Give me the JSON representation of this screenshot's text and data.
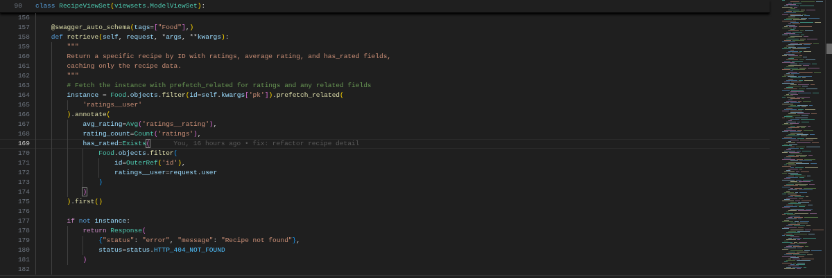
{
  "sticky_line": {
    "number": "90",
    "tokens": [
      {
        "kind": "kw",
        "text": "class "
      },
      {
        "kind": "cls",
        "text": "RecipeViewSet"
      },
      {
        "kind": "p1",
        "text": "("
      },
      {
        "kind": "cls",
        "text": "viewsets"
      },
      {
        "kind": "op",
        "text": "."
      },
      {
        "kind": "cls",
        "text": "ModelViewSet"
      },
      {
        "kind": "p1",
        "text": ")"
      },
      {
        "kind": "op",
        "text": ":"
      }
    ]
  },
  "lines": [
    {
      "number": "156",
      "current": false
    },
    {
      "number": "157",
      "current": false,
      "tokens": [
        {
          "kind": "fn",
          "text": "@swagger_auto_schema"
        },
        {
          "kind": "p1",
          "text": "("
        },
        {
          "kind": "var",
          "text": "tags"
        },
        {
          "kind": "op",
          "text": "="
        },
        {
          "kind": "p2",
          "text": "["
        },
        {
          "kind": "str",
          "text": "\"Food\""
        },
        {
          "kind": "p2",
          "text": "]"
        },
        {
          "kind": "op",
          "text": ","
        },
        {
          "kind": "p1",
          "text": ")"
        }
      ]
    },
    {
      "number": "158",
      "current": false,
      "tokens": [
        {
          "kind": "kw",
          "text": "def "
        },
        {
          "kind": "fn",
          "text": "retrieve"
        },
        {
          "kind": "p1",
          "text": "("
        },
        {
          "kind": "var",
          "text": "self"
        },
        {
          "kind": "op",
          "text": ", "
        },
        {
          "kind": "var",
          "text": "request"
        },
        {
          "kind": "op",
          "text": ", *"
        },
        {
          "kind": "var",
          "text": "args"
        },
        {
          "kind": "op",
          "text": ", **"
        },
        {
          "kind": "var",
          "text": "kwargs"
        },
        {
          "kind": "p1",
          "text": ")"
        },
        {
          "kind": "op",
          "text": ":"
        }
      ],
      "children": [
        {
          "number": "159",
          "current": false,
          "tokens": [
            {
              "kind": "str",
              "text": "\"\"\""
            }
          ]
        },
        {
          "number": "160",
          "current": false,
          "tokens": [
            {
              "kind": "str",
              "text": "Return a specific recipe by ID with ratings, average rating, and has_rated fields,"
            }
          ]
        },
        {
          "number": "161",
          "current": false,
          "tokens": [
            {
              "kind": "str",
              "text": "caching only the recipe data."
            }
          ]
        },
        {
          "number": "162",
          "current": false,
          "tokens": [
            {
              "kind": "str",
              "text": "\"\"\""
            }
          ]
        },
        {
          "number": "163",
          "current": false,
          "tokens": [
            {
              "kind": "com",
              "text": "# Fetch the instance with prefetch_related for ratings and any related fields"
            }
          ]
        },
        {
          "number": "164",
          "current": false,
          "tokens": [
            {
              "kind": "var",
              "text": "instance"
            },
            {
              "kind": "op",
              "text": " = "
            },
            {
              "kind": "cls",
              "text": "Food"
            },
            {
              "kind": "op",
              "text": "."
            },
            {
              "kind": "var",
              "text": "objects"
            },
            {
              "kind": "op",
              "text": "."
            },
            {
              "kind": "fn",
              "text": "filter"
            },
            {
              "kind": "p1",
              "text": "("
            },
            {
              "kind": "var",
              "text": "id"
            },
            {
              "kind": "op",
              "text": "="
            },
            {
              "kind": "var",
              "text": "self"
            },
            {
              "kind": "op",
              "text": "."
            },
            {
              "kind": "var",
              "text": "kwargs"
            },
            {
              "kind": "p2",
              "text": "["
            },
            {
              "kind": "str",
              "text": "'pk'"
            },
            {
              "kind": "p2",
              "text": "]"
            },
            {
              "kind": "p1",
              "text": ")"
            },
            {
              "kind": "op",
              "text": "."
            },
            {
              "kind": "fn",
              "text": "prefetch_related"
            },
            {
              "kind": "p1",
              "text": "("
            }
          ],
          "children": [
            {
              "number": "165",
              "current": false,
              "tokens": [
                {
                  "kind": "str",
                  "text": "'ratings__user'"
                }
              ]
            }
          ]
        },
        {
          "number": "166",
          "current": false,
          "tokens": [
            {
              "kind": "p1",
              "text": ")"
            },
            {
              "kind": "op",
              "text": "."
            },
            {
              "kind": "fn",
              "text": "annotate"
            },
            {
              "kind": "p1",
              "text": "("
            }
          ],
          "children": [
            {
              "number": "167",
              "current": false,
              "tokens": [
                {
                  "kind": "var",
                  "text": "avg_rating"
                },
                {
                  "kind": "op",
                  "text": "="
                },
                {
                  "kind": "cls",
                  "text": "Avg"
                },
                {
                  "kind": "p2",
                  "text": "("
                },
                {
                  "kind": "str",
                  "text": "'ratings__rating'"
                },
                {
                  "kind": "p2",
                  "text": ")"
                },
                {
                  "kind": "op",
                  "text": ","
                }
              ]
            },
            {
              "number": "168",
              "current": false,
              "tokens": [
                {
                  "kind": "var",
                  "text": "rating_count"
                },
                {
                  "kind": "op",
                  "text": "="
                },
                {
                  "kind": "cls",
                  "text": "Count"
                },
                {
                  "kind": "p2",
                  "text": "("
                },
                {
                  "kind": "str",
                  "text": "'ratings'"
                },
                {
                  "kind": "p2",
                  "text": ")"
                },
                {
                  "kind": "op",
                  "text": ","
                }
              ]
            },
            {
              "number": "169",
              "current": true,
              "blame": "You, 16 hours ago • fix: refactor recipe detail",
              "tokens": [
                {
                  "kind": "var",
                  "text": "has_rated"
                },
                {
                  "kind": "op",
                  "text": "="
                },
                {
                  "kind": "cls",
                  "text": "Exists"
                },
                {
                  "kind": "p2m",
                  "text": "("
                }
              ],
              "children": [
                {
                  "number": "170",
                  "current": false,
                  "tokens": [
                    {
                      "kind": "cls",
                      "text": "Food"
                    },
                    {
                      "kind": "op",
                      "text": "."
                    },
                    {
                      "kind": "var",
                      "text": "objects"
                    },
                    {
                      "kind": "op",
                      "text": "."
                    },
                    {
                      "kind": "fn",
                      "text": "filter"
                    },
                    {
                      "kind": "p3",
                      "text": "("
                    }
                  ],
                  "children": [
                    {
                      "number": "171",
                      "current": false,
                      "tokens": [
                        {
                          "kind": "var",
                          "text": "id"
                        },
                        {
                          "kind": "op",
                          "text": "="
                        },
                        {
                          "kind": "cls",
                          "text": "OuterRef"
                        },
                        {
                          "kind": "p1",
                          "text": "("
                        },
                        {
                          "kind": "str",
                          "text": "'id'"
                        },
                        {
                          "kind": "p1",
                          "text": ")"
                        },
                        {
                          "kind": "op",
                          "text": ","
                        }
                      ]
                    },
                    {
                      "number": "172",
                      "current": false,
                      "tokens": [
                        {
                          "kind": "var",
                          "text": "ratings__user"
                        },
                        {
                          "kind": "op",
                          "text": "="
                        },
                        {
                          "kind": "var",
                          "text": "request"
                        },
                        {
                          "kind": "op",
                          "text": "."
                        },
                        {
                          "kind": "var",
                          "text": "user"
                        }
                      ]
                    }
                  ]
                },
                {
                  "number": "173",
                  "current": false,
                  "tokens": [
                    {
                      "kind": "p3",
                      "text": ")"
                    }
                  ]
                }
              ]
            },
            {
              "number": "174",
              "current": false,
              "tokens": [
                {
                  "kind": "p2m",
                  "text": ")"
                }
              ]
            }
          ]
        },
        {
          "number": "175",
          "current": false,
          "tokens": [
            {
              "kind": "p1",
              "text": ")"
            },
            {
              "kind": "op",
              "text": "."
            },
            {
              "kind": "fn",
              "text": "first"
            },
            {
              "kind": "p1",
              "text": "("
            },
            {
              "kind": "p1",
              "text": ")"
            }
          ]
        },
        {
          "number": "176",
          "current": false
        },
        {
          "number": "177",
          "current": false,
          "tokens": [
            {
              "kind": "ctl",
              "text": "if "
            },
            {
              "kind": "kw",
              "text": "not "
            },
            {
              "kind": "var",
              "text": "instance"
            },
            {
              "kind": "op",
              "text": ":"
            }
          ],
          "children": [
            {
              "number": "178",
              "current": false,
              "tokens": [
                {
                  "kind": "ctl",
                  "text": "return "
                },
                {
                  "kind": "cls",
                  "text": "Response"
                },
                {
                  "kind": "p2",
                  "text": "("
                }
              ],
              "children": [
                {
                  "number": "179",
                  "current": false,
                  "tokens": [
                    {
                      "kind": "p3",
                      "text": "{"
                    },
                    {
                      "kind": "str",
                      "text": "\"status\""
                    },
                    {
                      "kind": "op",
                      "text": ": "
                    },
                    {
                      "kind": "str",
                      "text": "\"error\""
                    },
                    {
                      "kind": "op",
                      "text": ", "
                    },
                    {
                      "kind": "str",
                      "text": "\"message\""
                    },
                    {
                      "kind": "op",
                      "text": ": "
                    },
                    {
                      "kind": "str",
                      "text": "\"Recipe not found\""
                    },
                    {
                      "kind": "p3",
                      "text": "}"
                    },
                    {
                      "kind": "op",
                      "text": ","
                    }
                  ]
                },
                {
                  "number": "180",
                  "current": false,
                  "tokens": [
                    {
                      "kind": "var",
                      "text": "status"
                    },
                    {
                      "kind": "op",
                      "text": "="
                    },
                    {
                      "kind": "var",
                      "text": "status"
                    },
                    {
                      "kind": "op",
                      "text": "."
                    },
                    {
                      "kind": "const",
                      "text": "HTTP_404_NOT_FOUND"
                    }
                  ]
                }
              ]
            },
            {
              "number": "181",
              "current": false,
              "tokens": [
                {
                  "kind": "p2",
                  "text": ")"
                }
              ]
            }
          ]
        },
        {
          "number": "182",
          "current": false
        }
      ]
    }
  ]
}
